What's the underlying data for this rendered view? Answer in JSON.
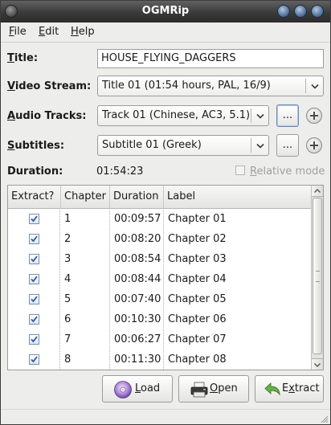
{
  "window": {
    "title": "OGMRip"
  },
  "menu": [
    {
      "pre": "",
      "key": "F",
      "post": "ile"
    },
    {
      "pre": "",
      "key": "E",
      "post": "dit"
    },
    {
      "pre": "",
      "key": "H",
      "post": "elp"
    }
  ],
  "form": {
    "title_label": {
      "key": "T",
      "post": "itle:"
    },
    "title_value": "HOUSE_FLYING_DAGGERS",
    "video_label": {
      "key": "V",
      "post": "ideo Stream:"
    },
    "video_value": "Title 01 (01:54 hours, PAL, 16/9)",
    "audio_label": {
      "key": "A",
      "post": "udio Tracks:"
    },
    "audio_value": "Track 01 (Chinese, AC3, 5.1)",
    "subs_label": {
      "key": "S",
      "post": "ubtitles:"
    },
    "subs_value": "Subtitle 01 (Greek)",
    "more_button": "...",
    "duration_label": "Duration:",
    "duration_value": "01:54:23",
    "relative_mode": {
      "key": "R",
      "post": "elative mode"
    }
  },
  "table": {
    "columns": [
      "Extract?",
      "Chapter",
      "Duration",
      "Label"
    ],
    "rows": [
      {
        "chapter": "1",
        "duration": "00:09:57",
        "label": "Chapter 01",
        "checked": true
      },
      {
        "chapter": "2",
        "duration": "00:08:20",
        "label": "Chapter 02",
        "checked": true
      },
      {
        "chapter": "3",
        "duration": "00:08:54",
        "label": "Chapter 03",
        "checked": true
      },
      {
        "chapter": "4",
        "duration": "00:08:44",
        "label": "Chapter 04",
        "checked": true
      },
      {
        "chapter": "5",
        "duration": "00:07:40",
        "label": "Chapter 05",
        "checked": true
      },
      {
        "chapter": "6",
        "duration": "00:10:30",
        "label": "Chapter 06",
        "checked": true
      },
      {
        "chapter": "7",
        "duration": "00:06:27",
        "label": "Chapter 07",
        "checked": true
      },
      {
        "chapter": "8",
        "duration": "00:11:30",
        "label": "Chapter 08",
        "checked": true
      }
    ]
  },
  "buttons": {
    "load": {
      "key": "L",
      "post": "oad"
    },
    "open": {
      "key": "O",
      "post": "pen"
    },
    "extract": {
      "pre": "E",
      "key": "x",
      "post": "tract"
    }
  },
  "icons": {
    "load": "disc-icon",
    "open": "printer-icon",
    "extract": "arrow-back-icon"
  }
}
